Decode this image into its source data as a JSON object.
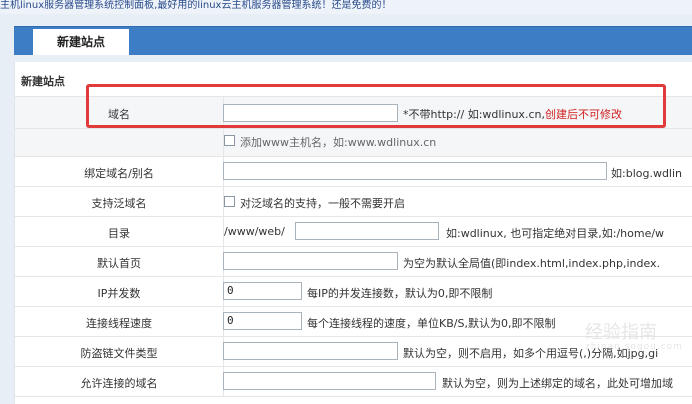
{
  "header": {
    "banner": "主机linux服务器管理系统控制面板,最好用的linux云主机服务器管理系统！还是免费的！"
  },
  "tabs": {
    "active": "新建站点"
  },
  "section": {
    "title": "新建站点"
  },
  "form": {
    "domain": {
      "label": "域名",
      "value": "",
      "hint_prefix": "*不带http:// 如:wdlinux.cn,",
      "hint_warning": "创建后不可修改"
    },
    "add_www": {
      "label": "添加www主机名，如:www.wdlinux.cn",
      "checked": false
    },
    "alias": {
      "label": "绑定域名/别名",
      "value": "",
      "hint": "如:blog.wdlin"
    },
    "wildcard": {
      "label": "支持泛域名",
      "checkbox_label": "对泛域名的支持，一般不需要开启",
      "checked": false
    },
    "directory": {
      "label": "目录",
      "prefix": "/www/web/",
      "value": "",
      "hint": "如:wdlinux, 也可指定绝对目录,如:/home/w"
    },
    "index": {
      "label": "默认首页",
      "value": "",
      "hint": "为空为默认全局值(即index.html,index.php,index."
    },
    "ip_conn": {
      "label": "IP并发数",
      "value": "0",
      "hint": "每IP的并发连接数，默认为0,即不限制"
    },
    "thread_speed": {
      "label": "连接线程速度",
      "value": "0",
      "hint": "每个连接线程的速度，单位KB/S,默认为0,即不限制"
    },
    "hotlink_types": {
      "label": "防盗链文件类型",
      "value": "",
      "hint": "默认为空，则不启用，如多个用逗号(,)分隔,如jpg,gi"
    },
    "allowed_domains": {
      "label": "允许连接的域名",
      "value": "",
      "hint": "默认为空，则为上述绑定的域名，此处可增加域"
    }
  },
  "watermark": {
    "text": "经验指南",
    "subtext": "zhinan.sogou.com"
  },
  "colors": {
    "tabbar": "#3d7dc6",
    "highlight": "#e03a3a",
    "warning": "#d21f1f"
  }
}
